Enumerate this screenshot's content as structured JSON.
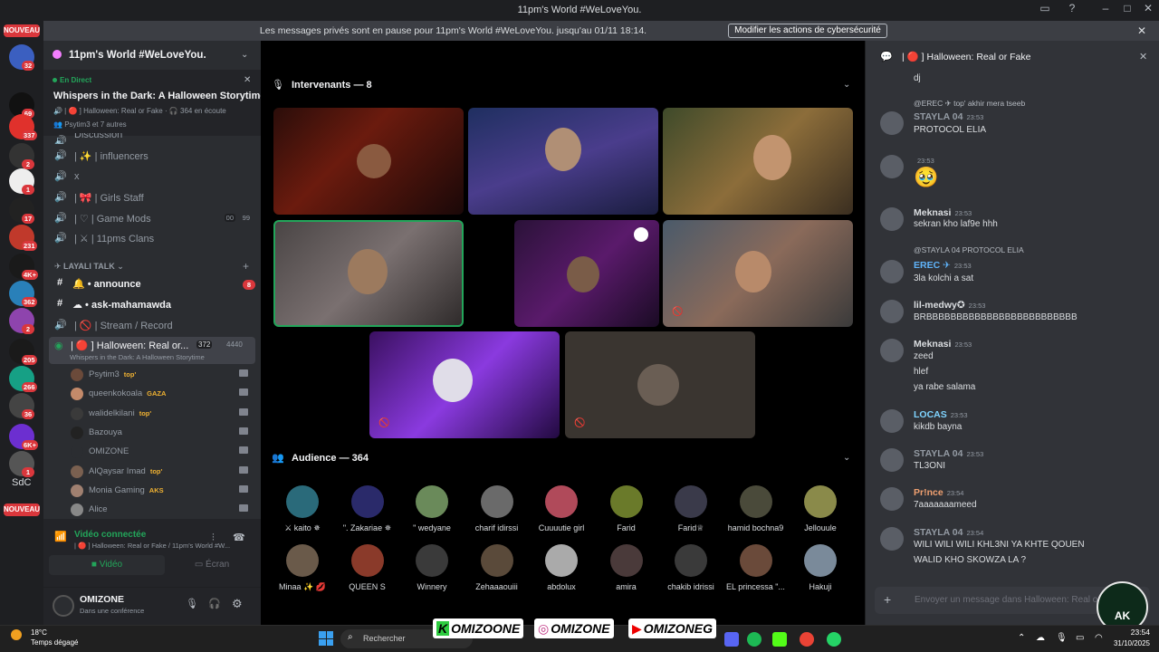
{
  "window": {
    "title": "11pm's World #WeLoveYou."
  },
  "notice": {
    "message": "Les messages privés sont en pause pour 11pm's World #WeLoveYou. jusqu'au 01/11 18:14.",
    "button": "Modifier les actions de cybersécurité"
  },
  "guilds": {
    "new_label": "NOUVEAU",
    "badges": [
      "32",
      "69",
      "337",
      "2",
      "1",
      "17",
      "231",
      "4K+",
      "362",
      "2",
      "205",
      "266",
      "36",
      "6K+",
      "1"
    ],
    "sdc": "SdC",
    "new_label2": "NOUVEAU"
  },
  "server": {
    "name": "11pm's World #WeLoveYou.",
    "live_label": "En Direct",
    "event_title": "Whispers in the Dark: A Halloween Storytime",
    "event_channel": "Halloween: Real or Fake",
    "listening": "364 en écoute",
    "participants": "Psytim3 et 7 autres"
  },
  "channels": {
    "partial": "Discussion",
    "items": [
      {
        "name": "influencers",
        "icon": "sparkles"
      },
      {
        "name": "x",
        "icon": ""
      },
      {
        "name": "Girls Staff",
        "icon": "bow"
      },
      {
        "name": "Game Mods",
        "icon": "heart",
        "count": "00",
        "limit": "99"
      },
      {
        "name": "11pms Clans",
        "icon": "swords"
      }
    ],
    "category": "LAYALI TALK",
    "text_channels": [
      {
        "name": "announce",
        "badge": "8"
      },
      {
        "name": "ask-mahamawda"
      }
    ],
    "stream": "Stream / Record",
    "active_voice": {
      "name": "Halloween: Real or...",
      "count": "372",
      "limit": "4440",
      "sub": "Whispers in the Dark: A Halloween Storytime"
    },
    "voice_users": [
      {
        "name": "Psytim3",
        "tag": "top'"
      },
      {
        "name": "queenkokoala",
        "tag": "GAZA"
      },
      {
        "name": "walidelkilani",
        "tag": "top'"
      },
      {
        "name": "Bazouya",
        "tag": ""
      },
      {
        "name": "OMIZONE",
        "tag": ""
      },
      {
        "name": "AlQaysar Imad",
        "tag": "top'"
      },
      {
        "name": "Monia Gaming",
        "tag": "AKS"
      },
      {
        "name": "Alice",
        "tag": ""
      }
    ]
  },
  "voice_panel": {
    "status": "Vidéo connectée",
    "channel": "Halloween: Real or Fake / 11pm's World #W...",
    "video_btn": "Vidéo",
    "screen_btn": "Écran"
  },
  "user_panel": {
    "name": "OMIZONE",
    "status": "Dans une conférence"
  },
  "stage": {
    "speakers_header": "Intervenants — 8",
    "audience_header": "Audience — 364",
    "audience": [
      "⚔ kaito ✵",
      "\". Zakariae ✵",
      "\" wedyane",
      "charif idirssi",
      "Cuuuutie girl",
      "Farid",
      "Farid♕",
      "hamid bochna9",
      "Jellouule",
      "Minaa ✨ 💋",
      "QUEEN S",
      "Winnery",
      "Zehaaaouiii",
      "abdolux",
      "amira",
      "chakib idrissi",
      "EL princessa \"...",
      "Hakuji"
    ]
  },
  "chat": {
    "channel": "Halloween: Real or Fake",
    "messages": [
      {
        "author": "",
        "time": "",
        "text": "dj",
        "reply": ""
      },
      {
        "author": "STAYLA 04",
        "time": "23:53",
        "text": "PROTOCOL ELIA",
        "reply": "@EREC ✈ top' akhir mera tseeb"
      },
      {
        "author": "",
        "time": "23:53",
        "text": "🥹",
        "reply": ""
      },
      {
        "author": "Meknasi",
        "time": "23:53",
        "text": "sekran kho laf9e hhh",
        "reply": ""
      },
      {
        "author": "EREC ✈",
        "time": "23:53",
        "text": "3la kolchi a sat",
        "reply": "@STAYLA 04 PROTOCOL ELIA"
      },
      {
        "author": "lil-medwy✪",
        "time": "23:53",
        "text": "BRBBBBBBBBBBBBBBBBBBBBBBBBB",
        "reply": ""
      },
      {
        "author": "Meknasi",
        "time": "23:53",
        "text": "zeed",
        "extra": [
          "hlef",
          "ya rabe salama"
        ]
      },
      {
        "author": "LOCAS",
        "time": "23:53",
        "text": "kikdb bayna"
      },
      {
        "author": "STAYLA 04",
        "time": "23:53",
        "text": "TL3ONI"
      },
      {
        "author": "Pr!nce",
        "time": "23:54",
        "text": "7aaaaaaameed"
      },
      {
        "author": "STAYLA 04",
        "time": "23:54",
        "text": "WILI WILI WILI KHL3NI YA KHTE QOUEN",
        "extra": [
          "WALID KHO SKOWZA LA ?"
        ]
      }
    ],
    "input_placeholder": "Envoyer un message dans  Halloween: Real or Fake"
  },
  "taskbar": {
    "weather_temp": "18°C",
    "weather_desc": "Temps dégagé",
    "search": "Rechercher",
    "overlay": [
      "OMIZOONE",
      "OMIZONE",
      "OMIZONEG"
    ],
    "time": "23:54",
    "date": "31/10/2025",
    "watermark": "AK"
  },
  "colors": {
    "accent": "#5865f2",
    "live": "#23a55a",
    "danger": "#da373c"
  }
}
